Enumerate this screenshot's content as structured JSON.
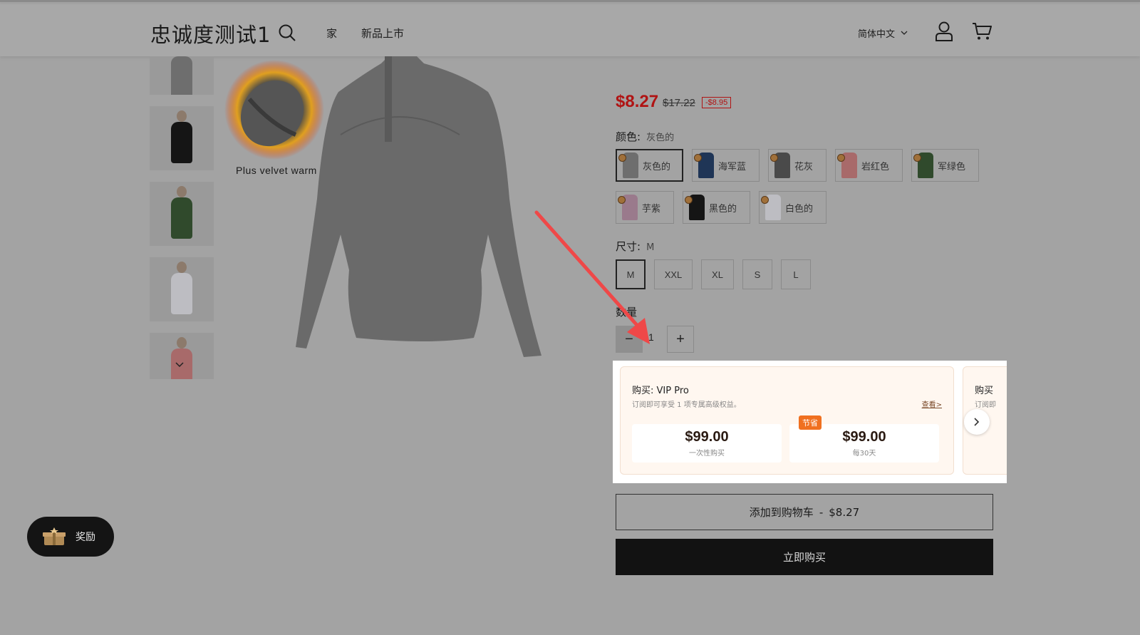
{
  "header": {
    "logo": "忠诚度测试1",
    "nav": [
      "家",
      "新品上市"
    ],
    "language": "简体中文"
  },
  "gallery": {
    "overlay_text": "Plus velvet warm"
  },
  "product": {
    "price": "$8.27",
    "compare_price": "$17.22",
    "discount_badge": "-$8.95",
    "color_label": "颜色:",
    "color_selected": "灰色的",
    "colors": [
      {
        "name": "灰色的",
        "hex": "#6e6e6e"
      },
      {
        "name": "海军蓝",
        "hex": "#1f3556"
      },
      {
        "name": "花灰",
        "hex": "#4a4a4a"
      },
      {
        "name": "岩红色",
        "hex": "#a86a6a"
      },
      {
        "name": "军绿色",
        "hex": "#304a2c"
      },
      {
        "name": "芋紫",
        "hex": "#9a7a8c"
      },
      {
        "name": "黑色的",
        "hex": "#151515"
      },
      {
        "name": "白色的",
        "hex": "#bdbdc2"
      }
    ],
    "size_label": "尺寸:",
    "size_selected": "M",
    "sizes": [
      "M",
      "XXL",
      "XL",
      "S",
      "L"
    ],
    "quantity_label": "数量",
    "quantity": "1"
  },
  "vip": {
    "title": "购买:  VIP Pro",
    "description": "订阅即可享受 1 项专属高级权益。",
    "link": "查看>",
    "save_badge": "节省",
    "plans": [
      {
        "price": "$99.00",
        "note": "一次性购买"
      },
      {
        "price": "$99.00",
        "note": "每30天"
      }
    ],
    "next_card_title": "购买",
    "next_card_desc": "订阅即"
  },
  "actions": {
    "add_to_cart": "添加到购物车",
    "add_to_cart_sep": "-",
    "add_to_cart_price": "$8.27",
    "buy_now": "立即购买"
  },
  "rewards": {
    "label": "奖励"
  },
  "colors": {
    "price_red": "#b01414",
    "annotation_arrow": "#ef4848",
    "vip_bg": "#fff7f0",
    "save_badge": "#f07020"
  }
}
